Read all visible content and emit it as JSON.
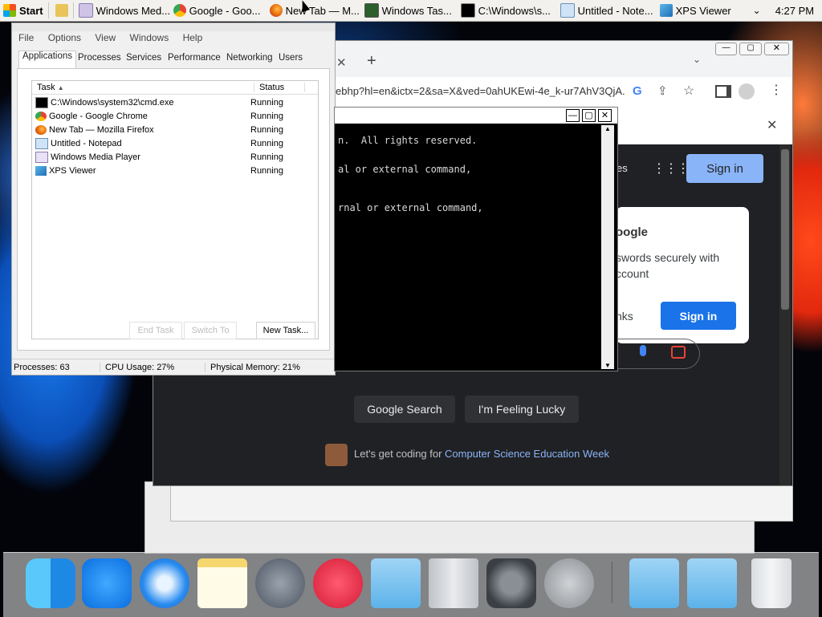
{
  "taskbar": {
    "start_label": "Start",
    "items": [
      {
        "label": "Windows Med..."
      },
      {
        "label": "Google - Goo..."
      },
      {
        "label": "New Tab — M..."
      },
      {
        "label": "Windows Tas..."
      },
      {
        "label": "C:\\Windows\\s..."
      },
      {
        "label": "Untitled - Note..."
      },
      {
        "label": "XPS Viewer"
      }
    ],
    "clock": "4:27 PM"
  },
  "task_manager": {
    "menu": [
      "File",
      "Options",
      "View",
      "Windows",
      "Help"
    ],
    "tabs": [
      "Applications",
      "Processes",
      "Services",
      "Performance",
      "Networking",
      "Users"
    ],
    "columns": {
      "task": "Task",
      "status": "Status"
    },
    "rows": [
      {
        "task": "C:\\Windows\\system32\\cmd.exe",
        "status": "Running",
        "icon": "cmd-icon"
      },
      {
        "task": "Google - Google Chrome",
        "status": "Running",
        "icon": "chrome-icon"
      },
      {
        "task": "New Tab — Mozilla Firefox",
        "status": "Running",
        "icon": "firefox-icon"
      },
      {
        "task": "Untitled - Notepad",
        "status": "Running",
        "icon": "notepad-icon"
      },
      {
        "task": "Windows Media Player",
        "status": "Running",
        "icon": "media-player-icon"
      },
      {
        "task": "XPS Viewer",
        "status": "Running",
        "icon": "xps-icon"
      }
    ],
    "buttons": {
      "end_task": "End Task",
      "switch_to": "Switch To",
      "new_task": "New Task..."
    },
    "status": {
      "processes": "Processes: 63",
      "cpu": "CPU Usage: 27%",
      "memory": "Physical Memory: 21%"
    }
  },
  "cmd": {
    "lines": [
      "n.  All rights reserved.",
      "al or external command,",
      "rnal or external command,"
    ]
  },
  "chrome": {
    "url": "ebhp?hl=en&ictx=2&sa=X&ved=0ahUKEwi-4e_k-ur7AhV3QjA...",
    "header_fragment": "es",
    "sign_in": "Sign in",
    "popup": {
      "title": "oogle",
      "line1": "swords securely with",
      "line2": "ccount",
      "no_thanks": "nks",
      "sign_in": "Sign in"
    },
    "buttons": {
      "search": "Google Search",
      "lucky": "I'm Feeling Lucky"
    },
    "doodle": {
      "prefix": "Let's get coding for",
      "link": "Computer Science Education Week"
    }
  }
}
